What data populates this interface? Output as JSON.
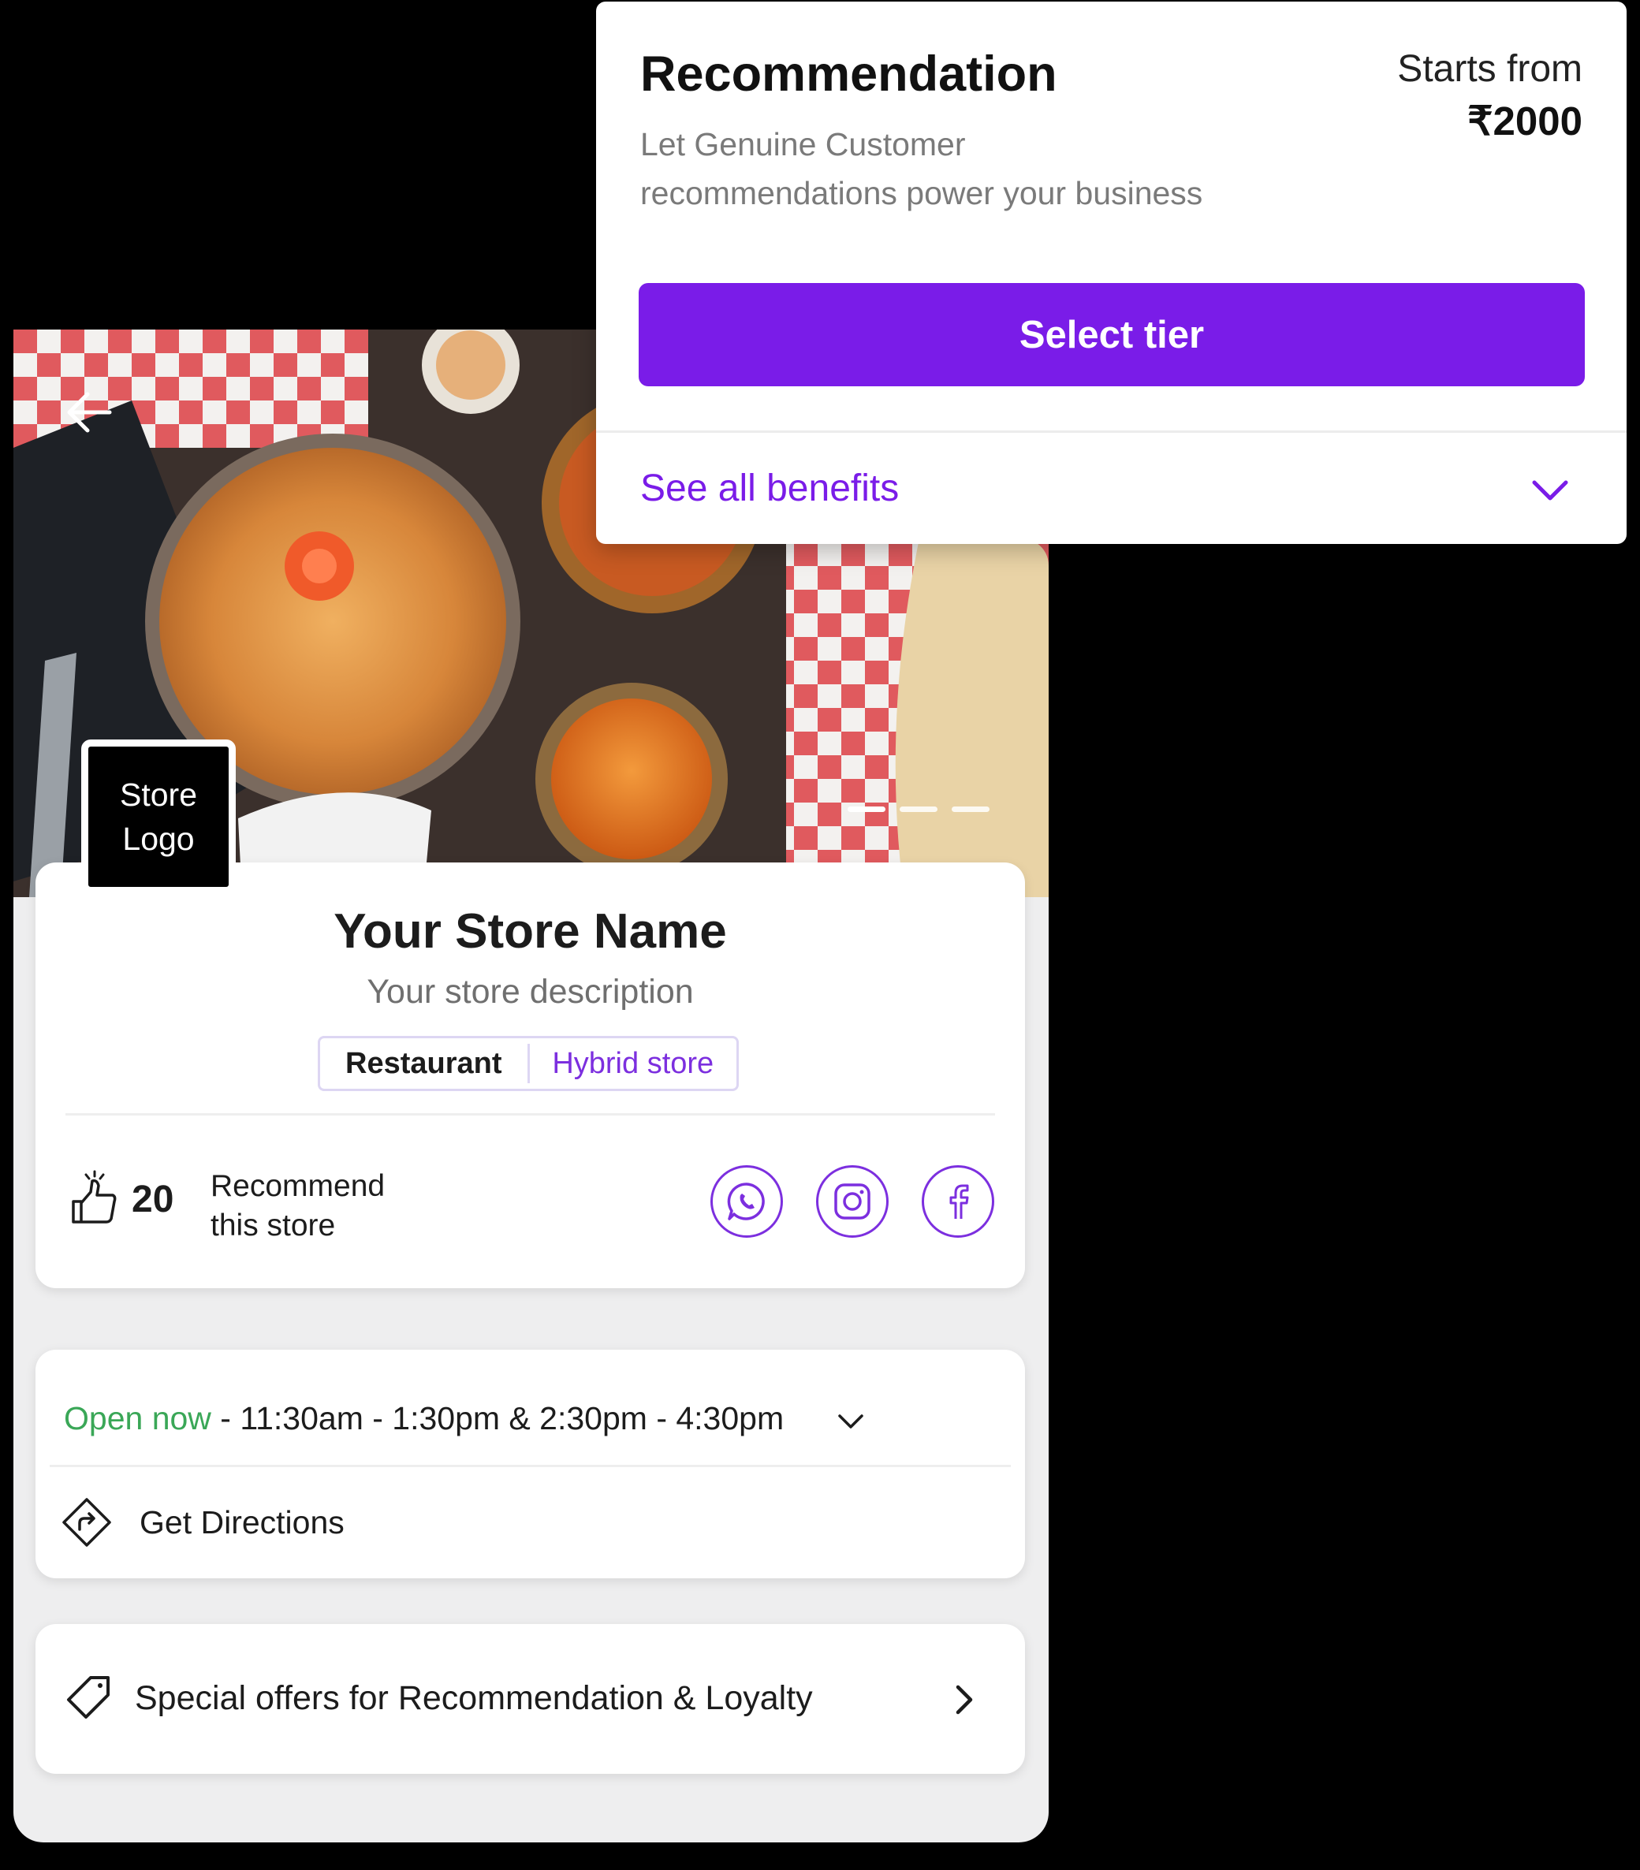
{
  "store": {
    "logo_line1": "Store",
    "logo_line2": "Logo",
    "name": "Your Store Name",
    "description": "Your store description",
    "tags": [
      "Restaurant",
      "Hybrid store"
    ],
    "recommend_count": "20",
    "recommend_label_line1": "Recommend",
    "recommend_label_line2": "this store",
    "social": [
      "whatsapp-icon",
      "instagram-icon",
      "facebook-icon"
    ]
  },
  "hours": {
    "status": "Open now",
    "times": " - 11:30am - 1:30pm & 2:30pm - 4:30pm",
    "directions_label": "Get Directions"
  },
  "offers": {
    "label": "Special offers for Recommendation & Loyalty"
  },
  "carousel": {
    "slides": 3,
    "active": 1
  },
  "popup": {
    "title": "Recommendation",
    "subtitle_line1": "Let Genuine Customer",
    "subtitle_line2": "recommendations power your business",
    "price_label": "Starts from",
    "price_value": "₹2000",
    "button_label": "Select tier",
    "benefits_label": "See all benefits"
  },
  "colors": {
    "accent": "#7a1ce8",
    "social_accent": "#7c2fdf",
    "open_green": "#3aa757"
  }
}
